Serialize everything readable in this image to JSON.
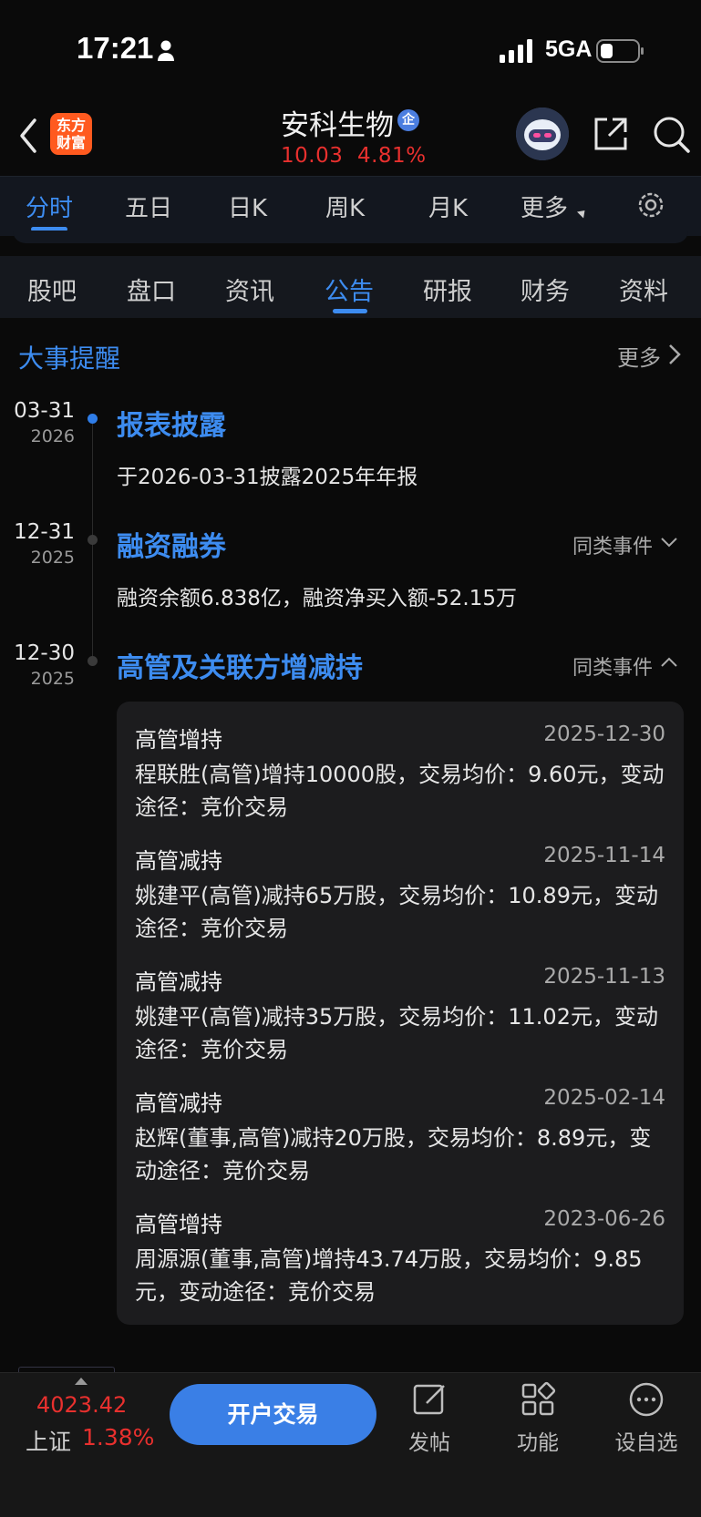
{
  "status_bar": {
    "time": "17:21",
    "network": "5GA"
  },
  "header": {
    "logo_line1": "东方",
    "logo_line2": "财富",
    "stock_name": "安科生物",
    "badge": "企",
    "price": "10.03",
    "change_pct": "4.81%"
  },
  "chart_tabs": [
    "分时",
    "五日",
    "日K",
    "周K",
    "月K",
    "更多"
  ],
  "info_tabs": [
    "股吧",
    "盘口",
    "资讯",
    "公告",
    "研报",
    "财务",
    "资料"
  ],
  "section": {
    "title": "大事提醒",
    "more": "更多"
  },
  "events": [
    {
      "md": "03-31",
      "year": "2026",
      "title": "报表披露",
      "desc": "于2026-03-31披露2025年年报",
      "similar": ""
    },
    {
      "md": "12-31",
      "year": "2025",
      "title": "融资融券",
      "desc": "融资余额6.838亿，融资净买入额-52.15万",
      "similar": "同类事件"
    },
    {
      "md": "12-30",
      "year": "2025",
      "title": "高管及关联方增减持",
      "desc": "",
      "similar": "同类事件"
    }
  ],
  "records": [
    {
      "type": "高管增持",
      "date": "2025-12-30",
      "desc": "程联胜(高管)增持10000股，交易均价：9.60元，变动途径：竞价交易"
    },
    {
      "type": "高管减持",
      "date": "2025-11-14",
      "desc": "姚建平(高管)减持65万股，交易均价：10.89元，变动途径：竞价交易"
    },
    {
      "type": "高管减持",
      "date": "2025-11-13",
      "desc": "姚建平(高管)减持35万股，交易均价：11.02元，变动途径：竞价交易"
    },
    {
      "type": "高管减持",
      "date": "2025-02-14",
      "desc": "赵辉(董事,高管)减持20万股，交易均价：8.89元，变动途径：竞价交易"
    },
    {
      "type": "高管增持",
      "date": "2023-06-26",
      "desc": "周源源(董事,高管)增持43.74万股，交易均价：9.85元，变动途径：竞价交易"
    }
  ],
  "bottom_bar": {
    "index_value": "4023.42",
    "index_name": "上证",
    "index_pct": "1.38%",
    "trade_button": "开户交易",
    "post": "发帖",
    "functions": "功能",
    "watchlist": "设自选"
  },
  "colors": {
    "accent": "#3d8cf0",
    "up_red": "#e8302e",
    "logo_orange": "#ff5a1f"
  }
}
